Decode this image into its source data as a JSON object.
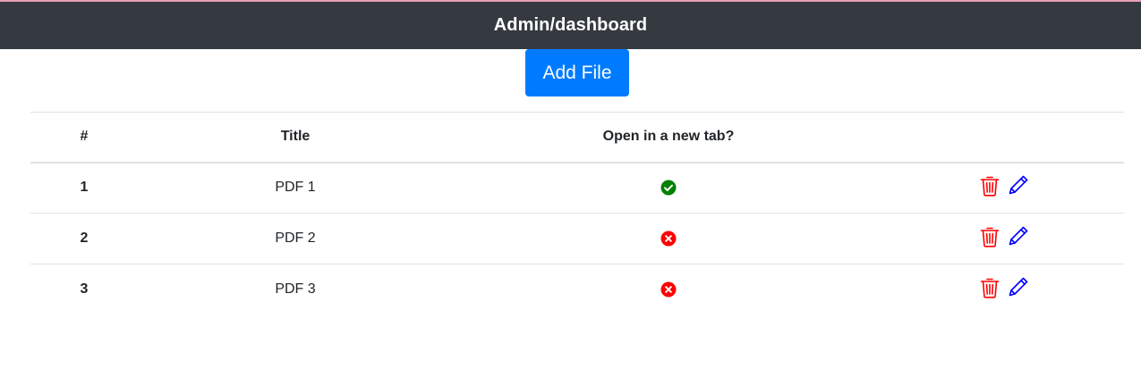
{
  "header": {
    "title": "Admin/dashboard"
  },
  "toolbar": {
    "add_label": "Add File"
  },
  "table": {
    "columns": [
      "#",
      "Title",
      "Open in a new tab?",
      ""
    ],
    "rows": [
      {
        "num": "1",
        "title": "PDF 1",
        "open_in_new_tab": true
      },
      {
        "num": "2",
        "title": "PDF 2",
        "open_in_new_tab": false
      },
      {
        "num": "3",
        "title": "PDF 3",
        "open_in_new_tab": false
      }
    ]
  },
  "icons": {
    "yes": "check-circle-icon",
    "no": "x-circle-icon",
    "delete": "trash-icon",
    "edit": "pencil-icon"
  },
  "colors": {
    "navbar": "#343a40",
    "primary": "#007bff",
    "success": "#008000",
    "danger": "#ff0000",
    "edit": "#0000ff"
  }
}
